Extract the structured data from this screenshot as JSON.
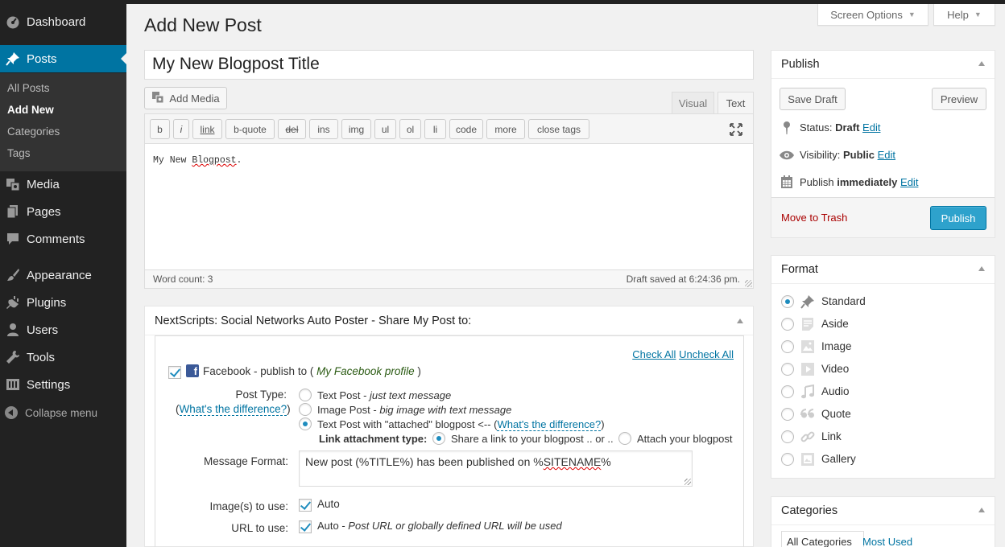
{
  "sidebar": {
    "dashboard": "Dashboard",
    "posts": "Posts",
    "sub": [
      "All Posts",
      "Add New",
      "Categories",
      "Tags"
    ],
    "media": "Media",
    "pages": "Pages",
    "comments": "Comments",
    "appearance": "Appearance",
    "plugins": "Plugins",
    "users": "Users",
    "tools": "Tools",
    "settings": "Settings",
    "collapse": "Collapse menu"
  },
  "header": {
    "title": "Add New Post",
    "screen_options": "Screen Options",
    "help": "Help"
  },
  "editor": {
    "post_title": "My New Blogpost Title",
    "add_media": "Add Media",
    "tab_visual": "Visual",
    "tab_text": "Text",
    "quicktags": [
      "b",
      "i",
      "link",
      "b-quote",
      "del",
      "ins",
      "img",
      "ul",
      "ol",
      "li",
      "code",
      "more",
      "close tags"
    ],
    "content_prefix": "My New ",
    "content_word": "Blogpost",
    "content_suffix": ".",
    "word_count": "Word count: 3",
    "draft_saved": "Draft saved at 6:24:36 pm."
  },
  "publish": {
    "title": "Publish",
    "save_draft": "Save Draft",
    "preview": "Preview",
    "status_label": "Status: ",
    "status_value": "Draft",
    "visibility_label": "Visibility: ",
    "visibility_value": "Public",
    "publish_label": "Publish ",
    "publish_value": "immediately",
    "edit": "Edit",
    "trash": "Move to Trash",
    "publish_btn": "Publish"
  },
  "format": {
    "title": "Format",
    "options": [
      "Standard",
      "Aside",
      "Image",
      "Video",
      "Audio",
      "Quote",
      "Link",
      "Gallery"
    ],
    "selected": "Standard"
  },
  "categories": {
    "title": "Categories",
    "tab_all": "All Categories",
    "tab_most": "Most Used"
  },
  "nextscripts": {
    "title": "NextScripts: Social Networks Auto Poster - Share My Post to:",
    "check_all": "Check All",
    "uncheck_all": "Uncheck All",
    "fb_label": "Facebook - publish to ( ",
    "fb_profile": "My Facebook profile",
    "fb_close": " )",
    "post_type": "Post Type:",
    "diff_open": "(",
    "whats_diff": "What's the difference?",
    "diff_close": ")",
    "opt1_a": "Text Post - ",
    "opt1_b": "just text message",
    "opt2_a": "Image Post - ",
    "opt2_b": "big image with text message",
    "opt3_a": "Text Post with \"attached\" blogpost <-- (",
    "opt3_close": ")",
    "link_attach": "Link attachment type:",
    "share_link": "Share a link to your blogpost .. or ..",
    "attach_blog": "Attach your blogpost",
    "msg_format": "Message Format:",
    "msg_value_a": "New post (%TITLE%) has been published on %",
    "msg_value_b": "SITENAME",
    "msg_value_c": "%",
    "images_label": "Image(s) to use:",
    "images_value": "Auto",
    "url_label": "URL to use:",
    "url_value_a": "Auto - ",
    "url_value_b": "Post URL or globally defined URL will be used"
  }
}
